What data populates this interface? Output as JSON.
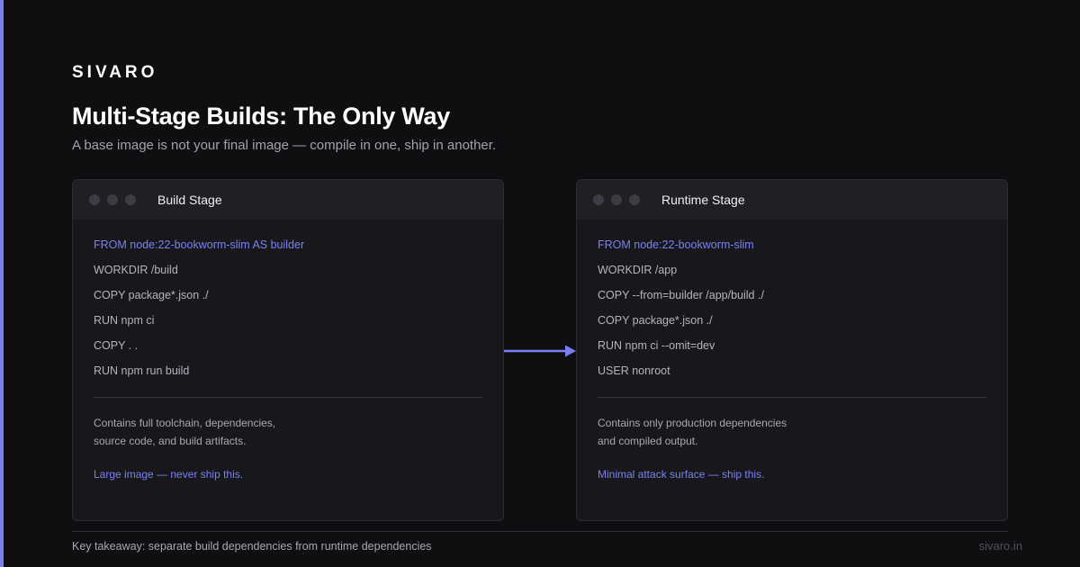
{
  "brand": "SIVARO",
  "title": "Multi-Stage Builds: The Only Way",
  "subtitle": "A base image is not your final image — compile in one, ship in another.",
  "accent_color": "#7b80f0",
  "cards": [
    {
      "title": "Build Stage",
      "code": [
        "FROM node:22-bookworm-slim AS builder",
        "WORKDIR /build",
        "COPY package*.json ./",
        "RUN npm ci",
        "COPY . .",
        "RUN npm run build"
      ],
      "description": [
        "Contains full toolchain, dependencies,",
        "source code, and build artifacts."
      ],
      "verdict": "Large image — never ship this."
    },
    {
      "title": "Runtime Stage",
      "code": [
        "FROM node:22-bookworm-slim",
        "WORKDIR /app",
        "COPY --from=builder /app/build ./",
        "COPY package*.json ./",
        "RUN npm ci --omit=dev",
        "USER nonroot"
      ],
      "description": [
        "Contains only production dependencies",
        "and compiled output."
      ],
      "verdict": "Minimal attack surface — ship this."
    }
  ],
  "footer": {
    "takeaway": "Key takeaway: separate build dependencies from runtime dependencies",
    "url": "sivaro.in"
  }
}
